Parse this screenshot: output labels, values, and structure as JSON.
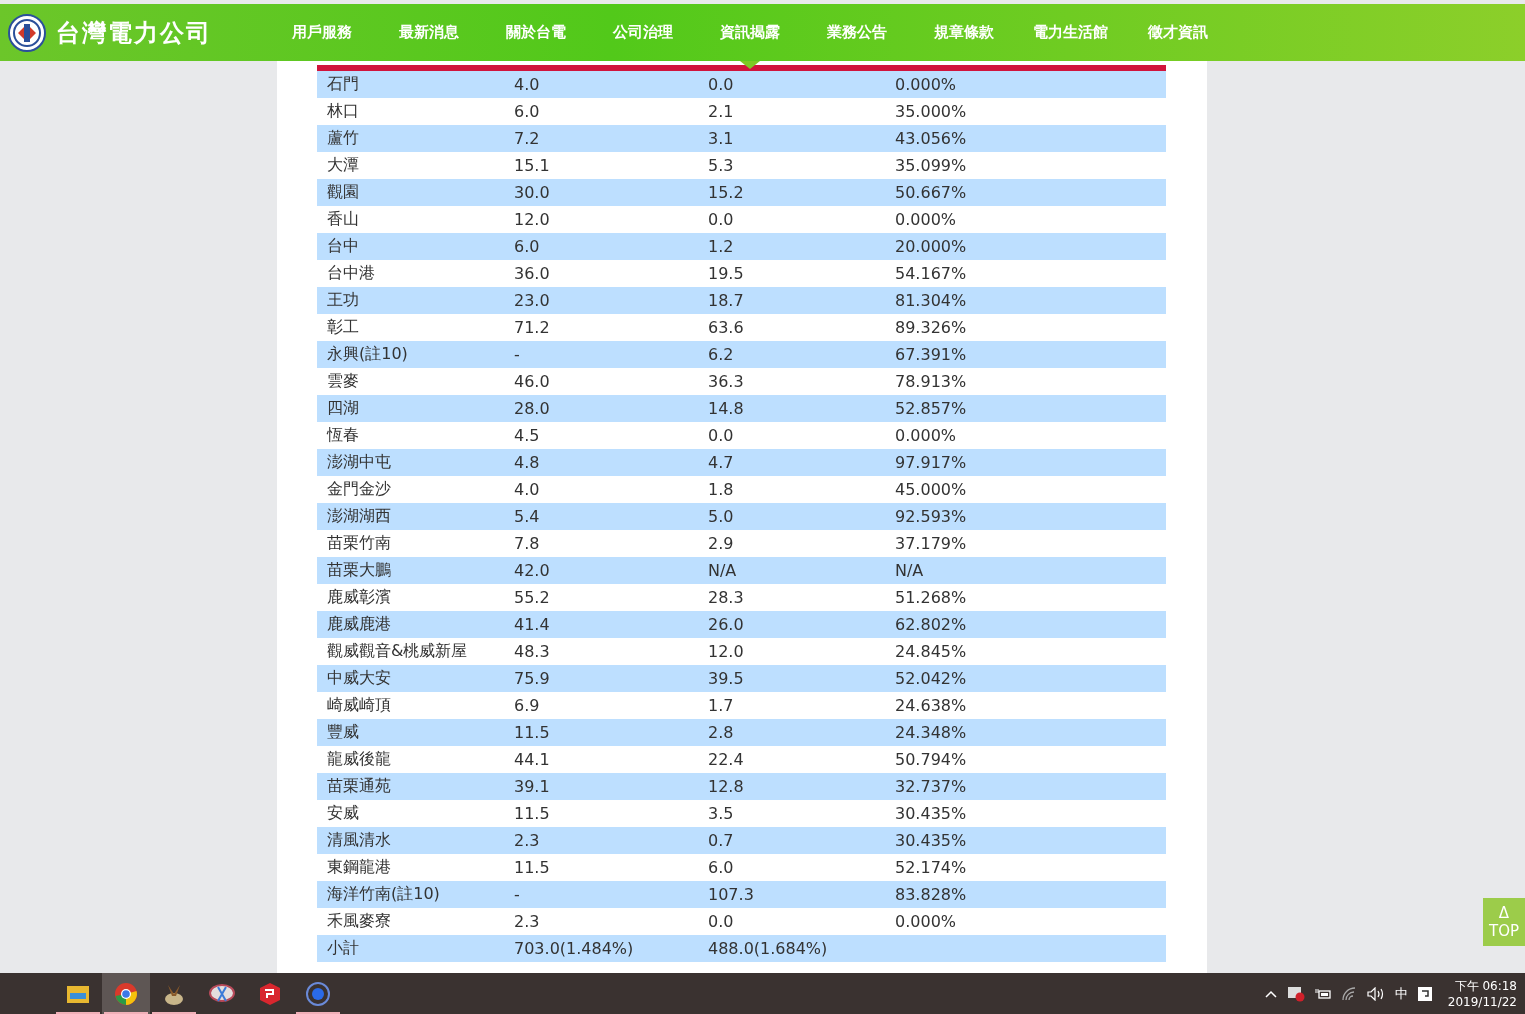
{
  "header": {
    "logo_text": "台灣電力公司",
    "nav": [
      {
        "label": "用戶服務",
        "selected": false
      },
      {
        "label": "最新消息",
        "selected": false
      },
      {
        "label": "關於台電",
        "selected": false
      },
      {
        "label": "公司治理",
        "selected": false
      },
      {
        "label": "資訊揭露",
        "selected": true
      },
      {
        "label": "業務公告",
        "selected": false
      },
      {
        "label": "規章條款",
        "selected": false
      },
      {
        "label": "電力生活館",
        "selected": false
      },
      {
        "label": "徵才資訊",
        "selected": false
      }
    ]
  },
  "table": {
    "rows": [
      [
        "石門",
        "4.0",
        "0.0",
        "0.000%"
      ],
      [
        "林口",
        "6.0",
        "2.1",
        "35.000%"
      ],
      [
        "蘆竹",
        "7.2",
        "3.1",
        "43.056%"
      ],
      [
        "大潭",
        "15.1",
        "5.3",
        "35.099%"
      ],
      [
        "觀園",
        "30.0",
        "15.2",
        "50.667%"
      ],
      [
        "香山",
        "12.0",
        "0.0",
        "0.000%"
      ],
      [
        "台中",
        "6.0",
        "1.2",
        "20.000%"
      ],
      [
        "台中港",
        "36.0",
        "19.5",
        "54.167%"
      ],
      [
        "王功",
        "23.0",
        "18.7",
        "81.304%"
      ],
      [
        "彰工",
        "71.2",
        "63.6",
        "89.326%"
      ],
      [
        "永興(註10)",
        "-",
        "6.2",
        "67.391%"
      ],
      [
        "雲麥",
        "46.0",
        "36.3",
        "78.913%"
      ],
      [
        "四湖",
        "28.0",
        "14.8",
        "52.857%"
      ],
      [
        "恆春",
        "4.5",
        "0.0",
        "0.000%"
      ],
      [
        "澎湖中屯",
        "4.8",
        "4.7",
        "97.917%"
      ],
      [
        "金門金沙",
        "4.0",
        "1.8",
        "45.000%"
      ],
      [
        "澎湖湖西",
        "5.4",
        "5.0",
        "92.593%"
      ],
      [
        "苗栗竹南",
        "7.8",
        "2.9",
        "37.179%"
      ],
      [
        "苗栗大鵬",
        "42.0",
        "N/A",
        "N/A"
      ],
      [
        "鹿威彰濱",
        "55.2",
        "28.3",
        "51.268%"
      ],
      [
        "鹿威鹿港",
        "41.4",
        "26.0",
        "62.802%"
      ],
      [
        "觀威觀音&桃威新屋",
        "48.3",
        "12.0",
        "24.845%"
      ],
      [
        "中威大安",
        "75.9",
        "39.5",
        "52.042%"
      ],
      [
        "崎威崎頂",
        "6.9",
        "1.7",
        "24.638%"
      ],
      [
        "豐威",
        "11.5",
        "2.8",
        "24.348%"
      ],
      [
        "龍威後龍",
        "44.1",
        "22.4",
        "50.794%"
      ],
      [
        "苗栗通苑",
        "39.1",
        "12.8",
        "32.737%"
      ],
      [
        "安威",
        "11.5",
        "3.5",
        "30.435%"
      ],
      [
        "清風清水",
        "2.3",
        "0.7",
        "30.435%"
      ],
      [
        "東鋼龍港",
        "11.5",
        "6.0",
        "52.174%"
      ],
      [
        "海洋竹南(註10)",
        "-",
        "107.3",
        "83.828%"
      ],
      [
        "禾風麥寮",
        "2.3",
        "0.0",
        "0.000%"
      ],
      [
        "小計",
        "703.0(1.484%)",
        "488.0(1.684%)",
        ""
      ]
    ]
  },
  "top_button": {
    "arrow": "Δ",
    "label": "TOP"
  },
  "taskbar": {
    "apps": [
      {
        "kind": "folder",
        "running": true,
        "selected": false
      },
      {
        "kind": "browser",
        "running": true,
        "selected": true
      },
      {
        "kind": "bird",
        "running": true,
        "selected": false
      },
      {
        "kind": "scissors",
        "running": false,
        "selected": false
      },
      {
        "kind": "cube",
        "running": false,
        "selected": false
      },
      {
        "kind": "globe",
        "running": true,
        "selected": false
      }
    ],
    "ime": "中",
    "time": "下午 06:18",
    "date": "2019/11/22"
  }
}
